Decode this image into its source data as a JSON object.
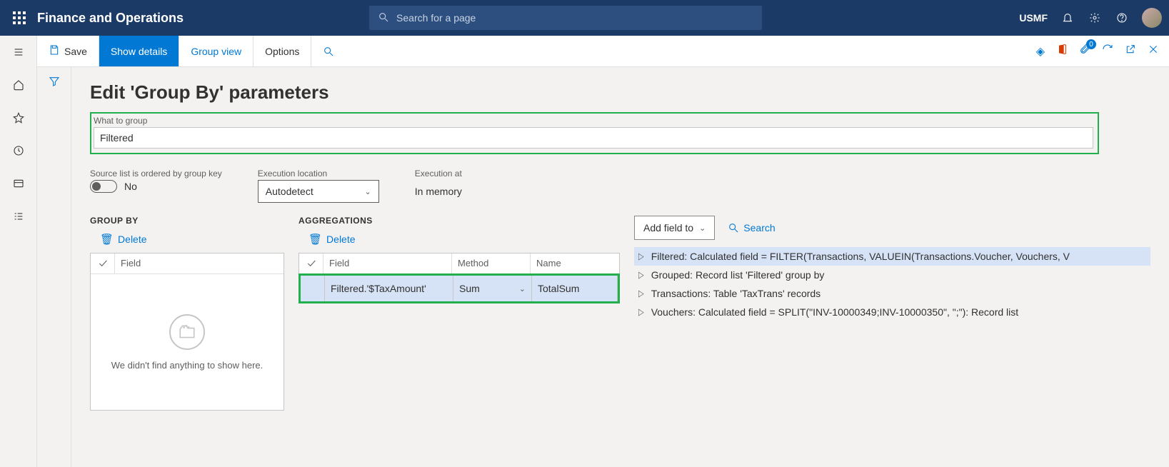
{
  "header": {
    "brand": "Finance and Operations",
    "search_placeholder": "Search for a page",
    "company": "USMF"
  },
  "actionbar": {
    "save": "Save",
    "show_details": "Show details",
    "group_view": "Group view",
    "options": "Options",
    "badge": "0"
  },
  "page": {
    "title": "Edit 'Group By' parameters",
    "what_to_group_label": "What to group",
    "what_to_group_value": "Filtered",
    "ordered_label": "Source list is ordered by group key",
    "ordered_value": "No",
    "exec_loc_label": "Execution location",
    "exec_loc_value": "Autodetect",
    "exec_at_label": "Execution at",
    "exec_at_value": "In memory"
  },
  "groupby": {
    "header": "GROUP BY",
    "delete": "Delete",
    "col_field": "Field",
    "empty_msg": "We didn't find anything to show here."
  },
  "agg": {
    "header": "AGGREGATIONS",
    "delete": "Delete",
    "col_field": "Field",
    "col_method": "Method",
    "col_name": "Name",
    "row": {
      "field": "Filtered.'$TaxAmount'",
      "method": "Sum",
      "name": "TotalSum"
    }
  },
  "right": {
    "add_field": "Add field to",
    "search": "Search",
    "items": [
      "Filtered: Calculated field = FILTER(Transactions, VALUEIN(Transactions.Voucher, Vouchers, V",
      "Grouped: Record list 'Filtered' group by",
      "Transactions: Table 'TaxTrans' records",
      "Vouchers: Calculated field = SPLIT(\"INV-10000349;INV-10000350\", \";\"): Record list"
    ]
  }
}
